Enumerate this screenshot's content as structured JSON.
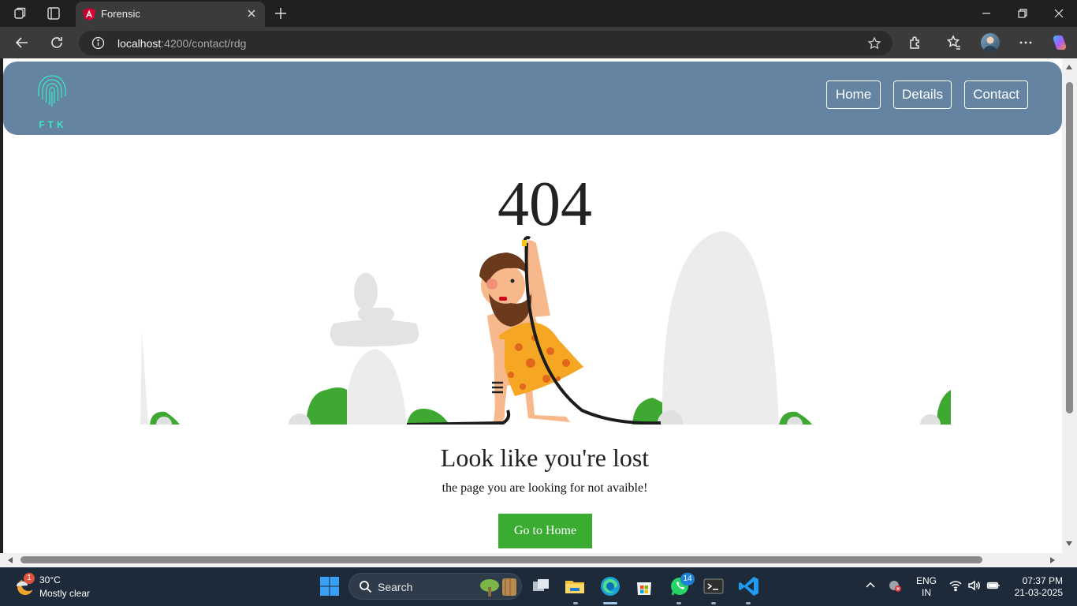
{
  "browser": {
    "tab_title": "Forensic",
    "url_host": "localhost",
    "url_path": ":4200/contact/rdg"
  },
  "header": {
    "logo_text": "FTK",
    "nav": [
      {
        "label": "Home"
      },
      {
        "label": "Details"
      },
      {
        "label": "Contact"
      }
    ]
  },
  "error_page": {
    "code": "404",
    "title": "Look like you're lost",
    "subtitle": "the page you are looking for not avaible!",
    "button_label": "Go to Home",
    "button_color": "#39ac31",
    "header_color": "#6484a2"
  },
  "taskbar": {
    "weather_badge": "1",
    "temperature": "30°C",
    "condition": "Mostly clear",
    "search_label": "Search",
    "whatsapp_badge": "14",
    "lang_line1": "ENG",
    "lang_line2": "IN",
    "time": "07:37 PM",
    "date": "21-03-2025"
  }
}
